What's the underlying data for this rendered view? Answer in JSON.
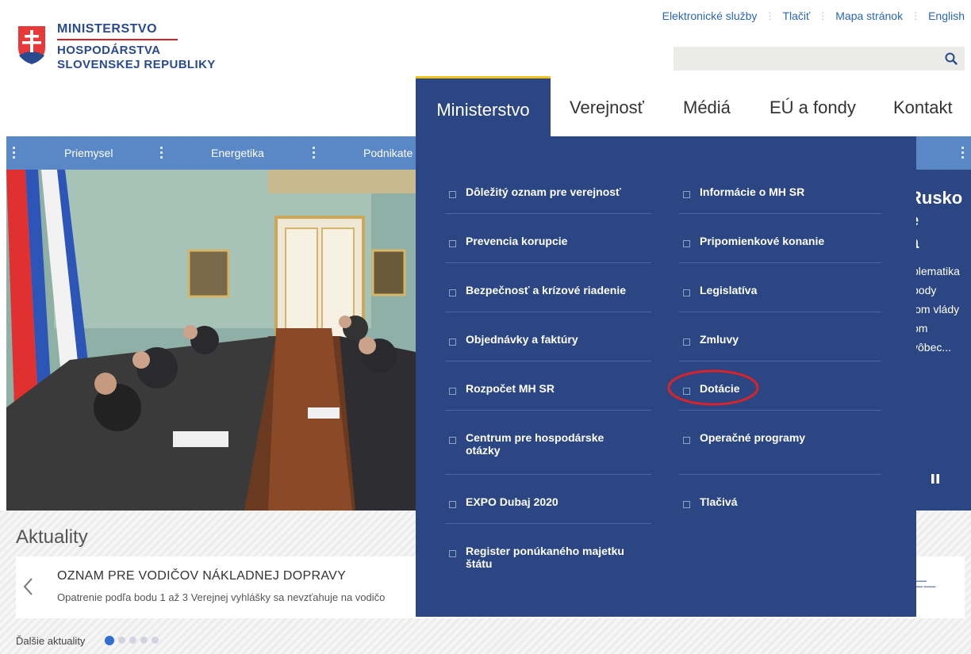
{
  "logo": {
    "line1": "MINISTERSTVO",
    "line2": "HOSPODÁRSTVA",
    "line3": "SLOVENSKEJ REPUBLIKY"
  },
  "utility_links": [
    "Elektronické služby",
    "Tlačiť",
    "Mapa stránok",
    "English"
  ],
  "search": {
    "placeholder": "",
    "icon": "search-icon"
  },
  "main_nav": [
    {
      "label": "Ministerstvo",
      "active": true
    },
    {
      "label": "Verejnosť"
    },
    {
      "label": "Médiá"
    },
    {
      "label": "EÚ a fondy"
    },
    {
      "label": "Kontakt"
    }
  ],
  "category_bar": [
    "Priemysel",
    "Energetika",
    "Podnikate"
  ],
  "hero": {
    "title_fragment": "Rusko\ne\na",
    "text_fragment": "blematika\nbody\nlom vlády\nom\nvôbec..."
  },
  "mega_menu": {
    "left": [
      "Dôležitý oznam pre verejnosť",
      "Prevencia korupcie",
      "Bezpečnosť a krízové riadenie",
      "Objednávky a faktúry",
      "Rozpočet MH SR",
      "Centrum pre hospodárske otázky",
      "EXPO Dubaj 2020",
      "Register ponúkaného majetku štátu"
    ],
    "right": [
      "Informácie o MH SR",
      "Pripomienkové konanie",
      "Legislatíva",
      "Zmluvy",
      "Dotácie",
      "Operačné programy",
      "Tlačivá"
    ],
    "highlighted": "Dotácie",
    "highlight_color": "#d8232a"
  },
  "news": {
    "heading": "Aktuality",
    "title": "OZNAM PRE VODIČOV NÁKLADNEJ DOPRAVY",
    "text": "Opatrenie podľa bodu 1 až 3 Verejnej vyhlášky sa nevzťahuje na vodičo",
    "more": "Ďalšie aktuality",
    "pager_count": 5,
    "pager_active": 1
  },
  "colors": {
    "brand_blue": "#2b4682",
    "bar_blue": "#5a88c6",
    "accent_yellow": "#f0c419",
    "link_blue": "#2a66b3"
  }
}
